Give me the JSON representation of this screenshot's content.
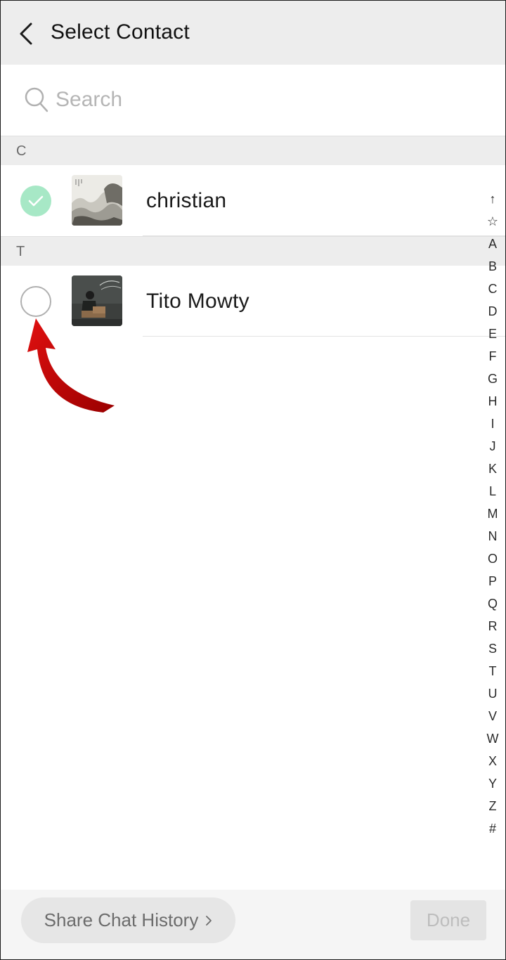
{
  "header": {
    "title": "Select Contact",
    "back_icon": "chevron-left-icon"
  },
  "search": {
    "placeholder": "Search",
    "value": ""
  },
  "sections": [
    {
      "letter": "C",
      "contacts": [
        {
          "name": "christian",
          "selected": true,
          "avatar": "landscape-painting"
        }
      ]
    },
    {
      "letter": "T",
      "contacts": [
        {
          "name": "Tito Mowty",
          "selected": false,
          "avatar": "person-photo"
        }
      ]
    }
  ],
  "index_bar": [
    "↑",
    "☆",
    "A",
    "B",
    "C",
    "D",
    "E",
    "F",
    "G",
    "H",
    "I",
    "J",
    "K",
    "L",
    "M",
    "N",
    "O",
    "P",
    "Q",
    "R",
    "S",
    "T",
    "U",
    "V",
    "W",
    "X",
    "Y",
    "Z",
    "#"
  ],
  "footer": {
    "share_label": "Share Chat History",
    "done_label": "Done"
  },
  "colors": {
    "header_bg": "#ededed",
    "checked": "#a7e8c6",
    "annotation_arrow": "#c40000"
  }
}
